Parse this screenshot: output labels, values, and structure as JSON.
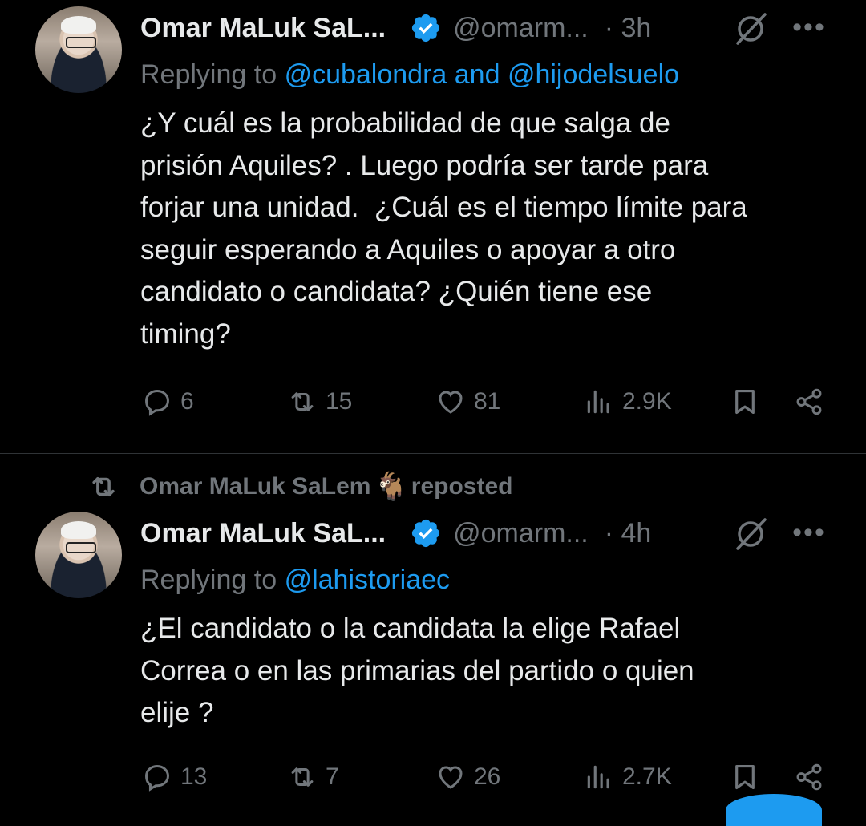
{
  "tweets": [
    {
      "author_name": "Omar MaLuk SaL...",
      "handle": "@omarm...",
      "time": "· 3h",
      "replying_prefix": "Replying to",
      "replying_links": "@cubalondra and @hijodelsuelo",
      "text": "¿Y cuál es la probabilidad de que salga de\nprisión Aquiles? . Luego podría ser tarde para\nforjar una unidad.  ¿Cuál es el tiempo límite para\nseguir esperando a Aquiles o apoyar a otro\ncandidato o candidata? ¿Quién tiene ese\ntiming?",
      "replies": "6",
      "reposts": "15",
      "likes": "81",
      "views": "2.9K"
    },
    {
      "author_name": "Omar MaLuk SaL...",
      "handle": "@omarm...",
      "time": "· 4h",
      "replying_prefix": "Replying to",
      "replying_links": "@lahistoriaec",
      "text": "¿El candidato o la candidata la elige Rafael\nCorrea o en las primarias del partido o quien\nelije ?",
      "replies": "13",
      "reposts": "7",
      "likes": "26",
      "views": "2.7K"
    }
  ],
  "repost_banner": {
    "name": "Omar MaLuk SaLem",
    "emoji": "🐐",
    "suffix": "reposted"
  },
  "more_label": "•••",
  "colors": {
    "accent": "#1d9bf0",
    "muted": "#71767b",
    "text": "#e7e9ea",
    "background": "#000000"
  }
}
